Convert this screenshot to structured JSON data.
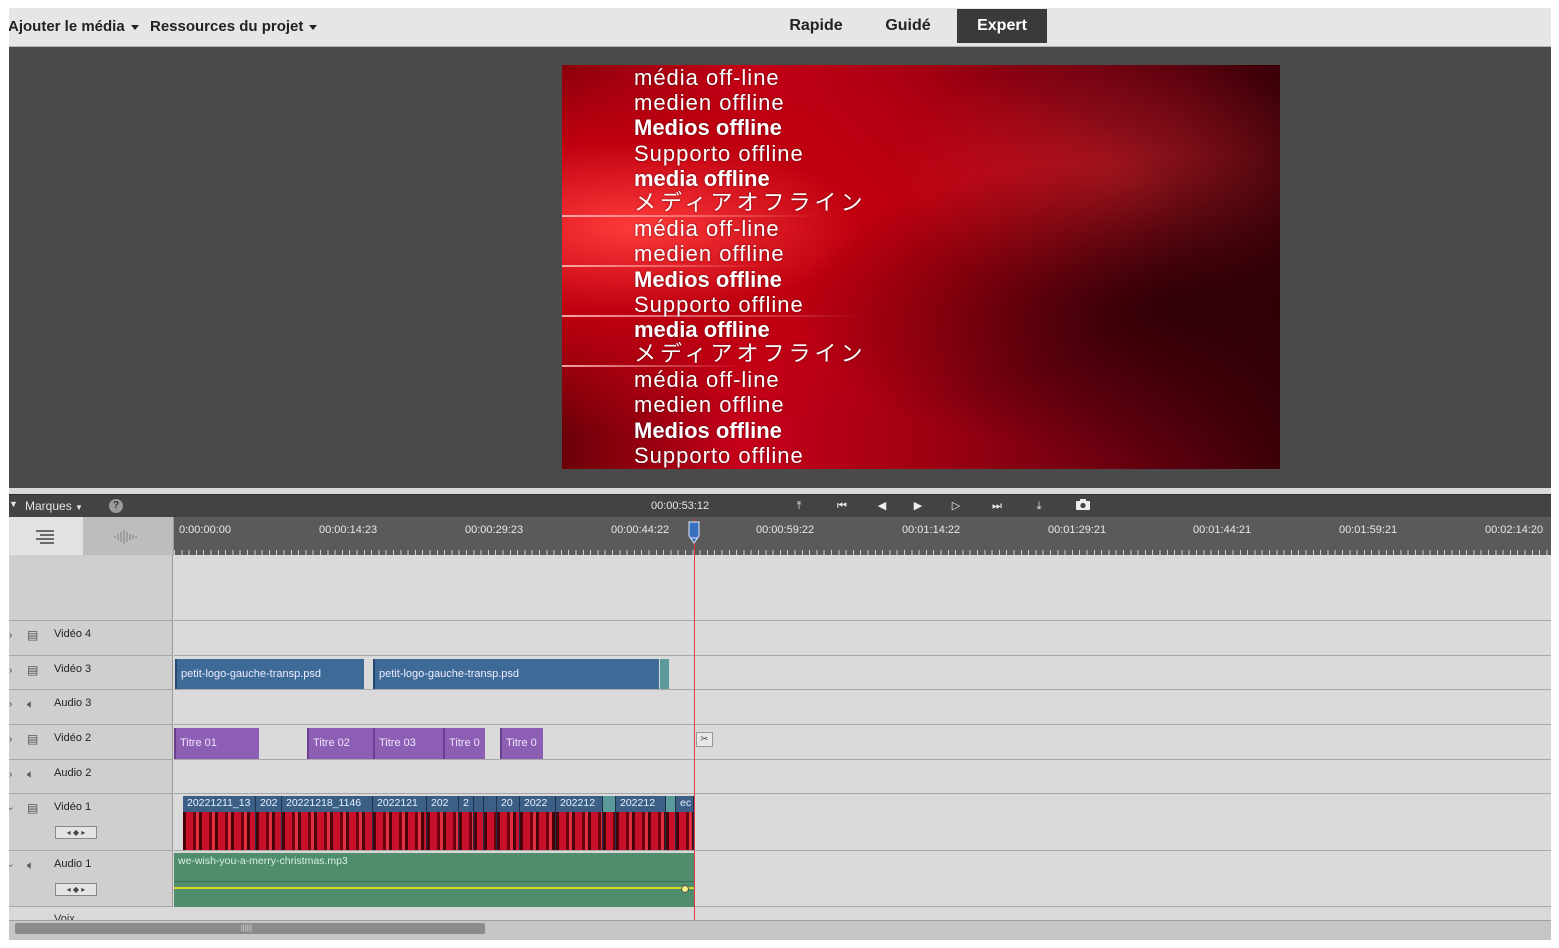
{
  "topbar": {
    "add_media": "Ajouter le média",
    "project_assets": "Ressources du projet",
    "modes": [
      "Rapide",
      "Guidé",
      "Expert"
    ],
    "active_mode": "Expert"
  },
  "preview": {
    "lines": [
      "média off-line",
      "medien offline",
      "Medios offline",
      "Supporto offline",
      "media offline",
      "メディアオフライン",
      "média off-line",
      "medien offline",
      "Medios offline",
      "Supporto offline",
      "media offline",
      "メディアオフライン",
      "média off-line",
      "medien offline",
      "Medios offline",
      "Supporto offline"
    ]
  },
  "timeline": {
    "marques_label": "Marques",
    "help": "?",
    "current_time": "00:00:53:12",
    "ruler_ticks": [
      "0:00:00:00",
      "00:00:14:23",
      "00:00:29:23",
      "00:00:44:22",
      "00:00:59:22",
      "00:01:14:22",
      "00:01:29:21",
      "00:01:44:21",
      "00:01:59:21",
      "00:02:14:20"
    ],
    "tracks": {
      "video4": "Vidéo 4",
      "video3": "Vidéo 3",
      "audio3": "Audio 3",
      "video2": "Vidéo 2",
      "audio2": "Audio 2",
      "video1": "Vidéo 1",
      "audio1": "Audio 1",
      "voix": "Voix"
    },
    "video3_clips": [
      "petit-logo-gauche-transp.psd",
      "petit-logo-gauche-transp.psd"
    ],
    "title_clips": [
      "Titre 01",
      "Titre 02",
      "Titre 03",
      "Titre 0",
      "Titre 0"
    ],
    "video1_clips": [
      "20221211_13",
      "202",
      "20221218_1146",
      "2022121",
      "202",
      "2",
      "",
      "",
      "20",
      "2022",
      "202212",
      "",
      "202212",
      "",
      "ec"
    ],
    "audio_clip": "we-wish-you-a-merry-christmas.mp3"
  }
}
